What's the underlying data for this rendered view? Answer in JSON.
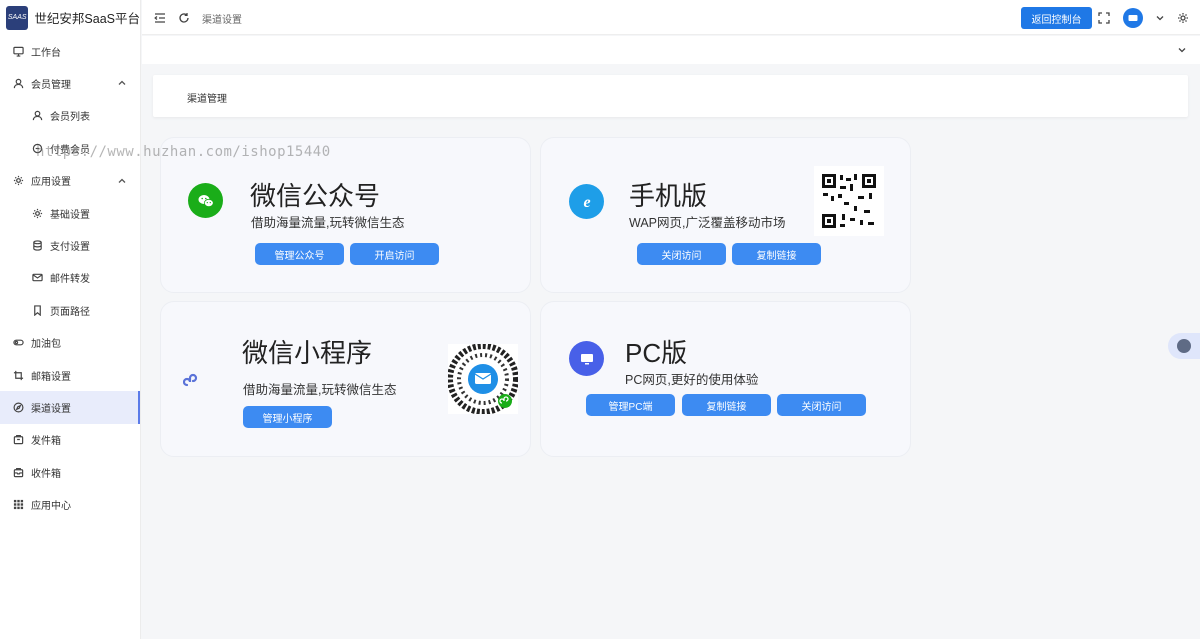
{
  "brand": {
    "title": "世纪安邦SaaS平台",
    "logo_text": "SAAS"
  },
  "sidebar": {
    "items": [
      {
        "label": "工作台",
        "icon": "monitor-icon",
        "sub": false
      },
      {
        "label": "会员管理",
        "icon": "user-icon",
        "sub": false,
        "expanded": true
      },
      {
        "label": "会员列表",
        "icon": "user-icon",
        "sub": true
      },
      {
        "label": "付费会员",
        "icon": "coin-icon",
        "sub": true
      },
      {
        "label": "应用设置",
        "icon": "gear-icon",
        "sub": false,
        "expanded": true
      },
      {
        "label": "基础设置",
        "icon": "gear-icon",
        "sub": true
      },
      {
        "label": "支付设置",
        "icon": "database-icon",
        "sub": true
      },
      {
        "label": "邮件转发",
        "icon": "mail-icon",
        "sub": true
      },
      {
        "label": "页面路径",
        "icon": "bookmark-icon",
        "sub": true
      },
      {
        "label": "加油包",
        "icon": "toggle-icon",
        "sub": false
      },
      {
        "label": "邮箱设置",
        "icon": "crop-icon",
        "sub": false
      },
      {
        "label": "渠道设置",
        "icon": "compass-icon",
        "sub": false,
        "active": true
      },
      {
        "label": "发件箱",
        "icon": "outbox-icon",
        "sub": false
      },
      {
        "label": "收件箱",
        "icon": "inbox-icon",
        "sub": false
      },
      {
        "label": "应用中心",
        "icon": "grid-icon",
        "sub": false
      }
    ]
  },
  "topbar": {
    "breadcrumb": "渠道设置",
    "console_button": "返回控制台"
  },
  "panel": {
    "title": "渠道管理"
  },
  "watermark": "https://www.huzhan.com/ishop15440",
  "cards": {
    "wechat_official": {
      "title": "微信公众号",
      "desc": "借助海量流量,玩转微信生态",
      "buttons": [
        "管理公众号",
        "开启访问"
      ],
      "icon_color": "#1aad19"
    },
    "mobile": {
      "title": "手机版",
      "desc": "WAP网页,广泛覆盖移动市场",
      "buttons": [
        "关闭访问",
        "复制链接"
      ],
      "icon_color": "#1e9ee8"
    },
    "mini_program": {
      "title": "微信小程序",
      "desc": "借助海量流量,玩转微信生态",
      "buttons": [
        "管理小程序"
      ],
      "icon_color": "#5b73d8"
    },
    "pc": {
      "title": "PC版",
      "desc": "PC网页,更好的使用体验",
      "buttons": [
        "管理PC端",
        "复制链接",
        "关闭访问"
      ],
      "icon_color": "#4860e8"
    }
  },
  "colors": {
    "primary": "#1f78e6",
    "card_button": "#3d8bf2",
    "active_menu": "#e8ecfb"
  }
}
